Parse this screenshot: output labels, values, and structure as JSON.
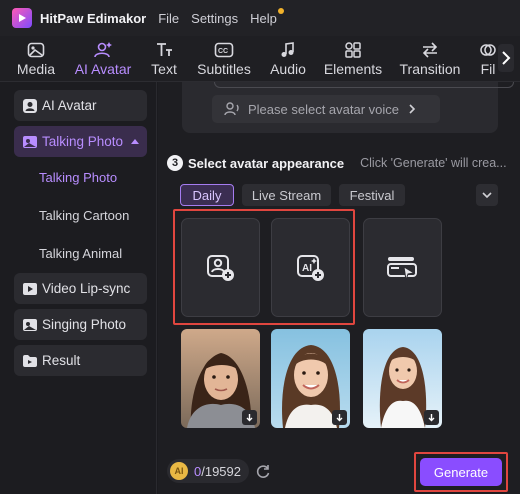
{
  "app": {
    "title": "HitPaw Edimakor",
    "menu": [
      "File",
      "Settings",
      "Help"
    ]
  },
  "tabs": [
    {
      "label": "Media",
      "icon": "image-icon",
      "active": false
    },
    {
      "label": "AI Avatar",
      "icon": "ai-avatar-icon",
      "active": true
    },
    {
      "label": "Text",
      "icon": "text-icon",
      "active": false
    },
    {
      "label": "Subtitles",
      "icon": "subtitles-icon",
      "active": false
    },
    {
      "label": "Audio",
      "icon": "music-icon",
      "active": false
    },
    {
      "label": "Elements",
      "icon": "elements-icon",
      "active": false
    },
    {
      "label": "Transition",
      "icon": "transition-icon",
      "active": false
    },
    {
      "label": "Fil",
      "icon": "filter-icon",
      "active": false
    }
  ],
  "sidebar": {
    "ai_avatar": "AI Avatar",
    "talking_photo": "Talking Photo",
    "sub_items": [
      "Talking Photo",
      "Talking Cartoon",
      "Talking Animal"
    ],
    "video_lipsync": "Video Lip-sync",
    "singing_photo": "Singing Photo",
    "result": "Result"
  },
  "voice": {
    "placeholder": "Please select avatar voice"
  },
  "appearance": {
    "step_number": "3",
    "title": "Select avatar appearance",
    "hint": "Click 'Generate' will crea..."
  },
  "filters": [
    "Daily",
    "Live Stream",
    "Festival"
  ],
  "active_filter": "Daily",
  "upload_tiles": [
    "upload-photo-icon",
    "ai-generate-avatar-icon",
    "template-avatar-icon"
  ],
  "avatar_photos": [
    "avatar-photo-1",
    "avatar-photo-2",
    "avatar-photo-3"
  ],
  "footer": {
    "coin_label": "AI",
    "credits_used": "0",
    "credits_total": "/19592",
    "generate_label": "Generate"
  },
  "colors": {
    "accent": "#8a4dff",
    "highlight_box": "#e0463f",
    "active_text": "#b88dff"
  }
}
